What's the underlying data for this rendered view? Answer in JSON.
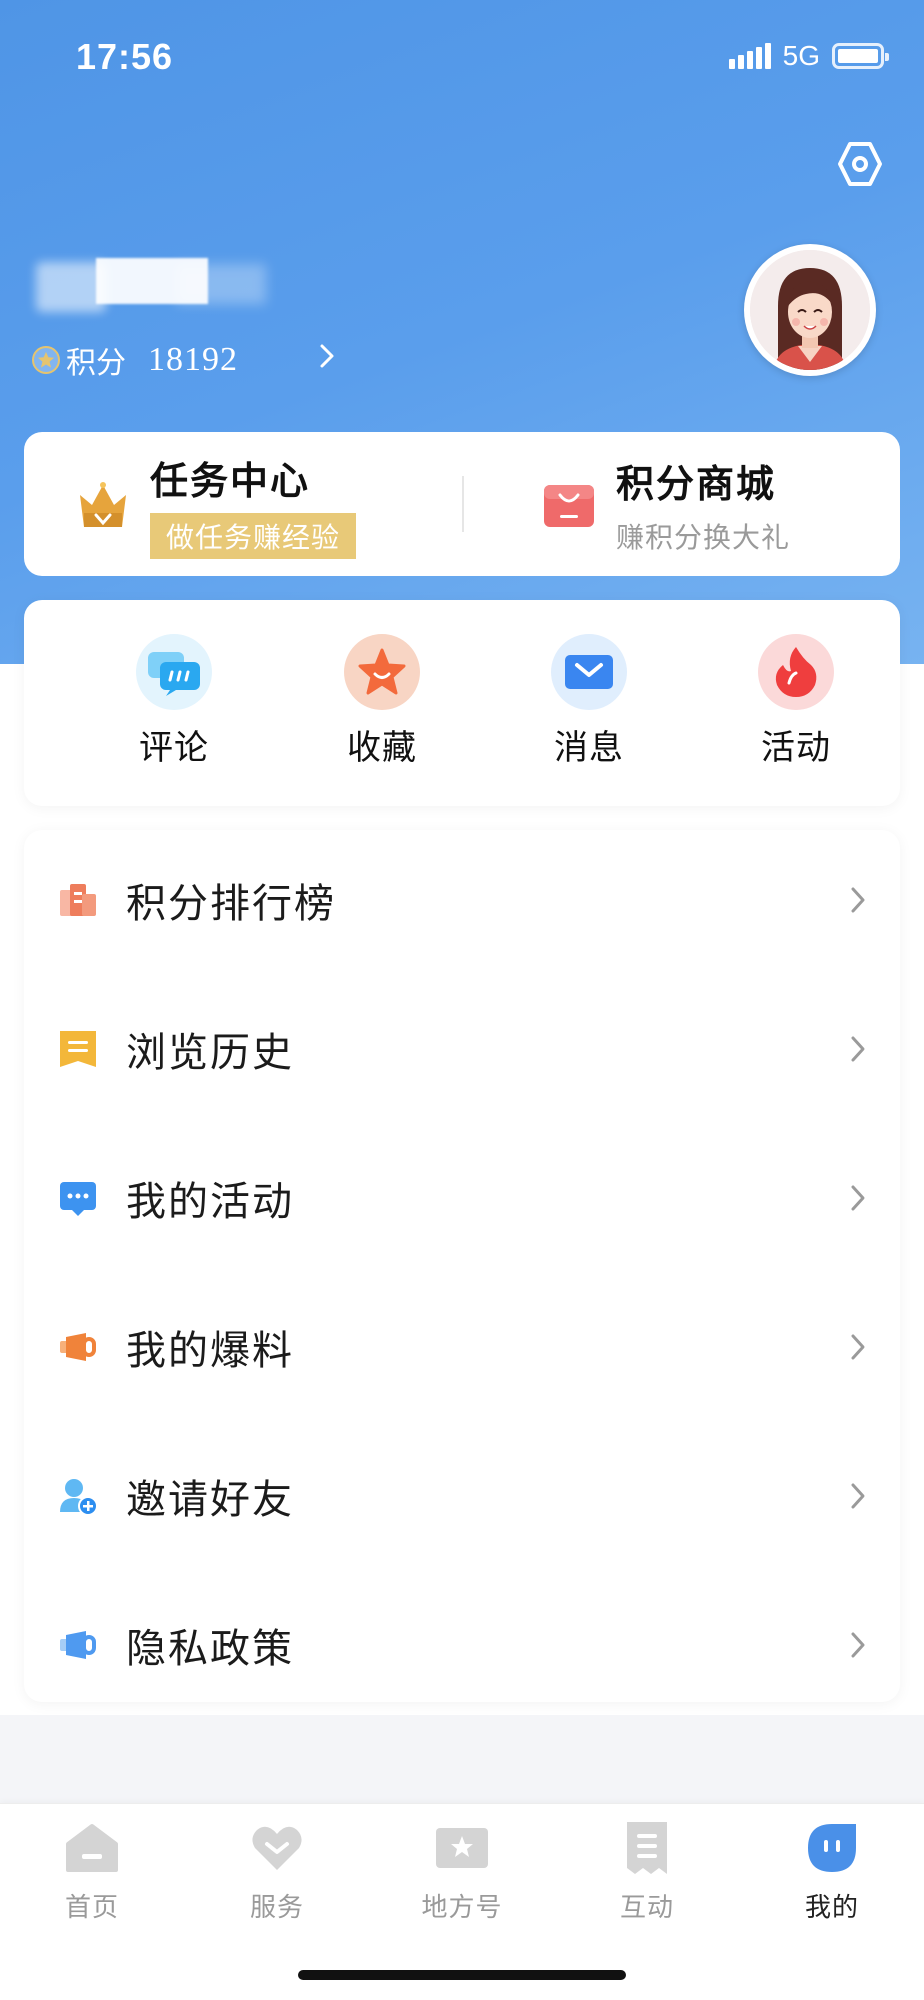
{
  "status_bar": {
    "time": "17:56",
    "network": "5G"
  },
  "profile": {
    "points_label": "积分",
    "points_value": "18192"
  },
  "task_center": {
    "title": "任务中心",
    "subtitle": "做任务赚经验"
  },
  "points_mall": {
    "title": "积分商城",
    "subtitle": "赚积分换大礼"
  },
  "quick_actions": [
    {
      "label": "评论",
      "icon": "comment-icon",
      "color": "#3bb4f5"
    },
    {
      "label": "收藏",
      "icon": "star-icon",
      "color": "#f36a3c"
    },
    {
      "label": "消息",
      "icon": "mail-icon",
      "color": "#3a86f0"
    },
    {
      "label": "活动",
      "icon": "flame-icon",
      "color": "#ef3e3e"
    }
  ],
  "menu": [
    {
      "label": "积分排行榜",
      "icon": "ranking-icon"
    },
    {
      "label": "浏览历史",
      "icon": "history-icon"
    },
    {
      "label": "我的活动",
      "icon": "activity-icon"
    },
    {
      "label": "我的爆料",
      "icon": "report-icon"
    },
    {
      "label": "邀请好友",
      "icon": "invite-friend-icon"
    },
    {
      "label": "隐私政策",
      "icon": "privacy-icon"
    }
  ],
  "tabbar": [
    {
      "label": "首页",
      "icon": "home-icon"
    },
    {
      "label": "服务",
      "icon": "heart-icon"
    },
    {
      "label": "地方号",
      "icon": "local-account-icon"
    },
    {
      "label": "互动",
      "icon": "interaction-icon"
    },
    {
      "label": "我的",
      "icon": "me-icon",
      "active": true
    }
  ],
  "colors": {
    "brand_blue": "#4f95e6",
    "gold": "#e8c978"
  }
}
